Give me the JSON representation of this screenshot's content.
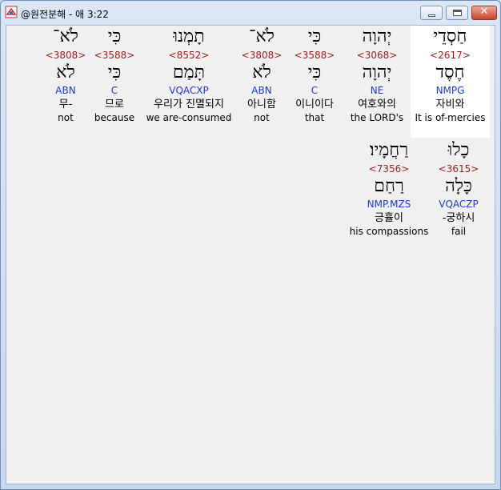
{
  "window": {
    "title": "@원전분해 - 애 3:22"
  },
  "verse": {
    "row1": [
      {
        "heb": "חַסְדֵי",
        "strong": "<2617>",
        "lemma": "חֶסֶד",
        "morph": "NMPG",
        "kor": "자비와",
        "eng": "It is of-mercies"
      },
      {
        "heb": "יְהוָה",
        "strong": "<3068>",
        "lemma": "יְהוָה",
        "morph": "NE",
        "kor": "여호와의",
        "eng": "the LORD's"
      },
      {
        "heb": "כִּי",
        "strong": "<3588>",
        "lemma": "כִּי",
        "morph": "C",
        "kor": "이니이다",
        "eng": "that"
      },
      {
        "heb": "לֹא־",
        "strong": "<3808>",
        "lemma": "לֹא",
        "morph": "ABN",
        "kor": "아니함",
        "eng": "not"
      },
      {
        "heb": "תָמְנוּ",
        "strong": "<8552>",
        "lemma": "תָּמַם",
        "morph": "VQACXP",
        "kor": "우리가 진멸되지",
        "eng": "we are-consumed"
      },
      {
        "heb": "כִּי",
        "strong": "<3588>",
        "lemma": "כִּי",
        "morph": "C",
        "kor": "므로",
        "eng": "because"
      },
      {
        "heb": "לֹא־",
        "strong": "<3808>",
        "lemma": "לֹא",
        "morph": "ABN",
        "kor": "무-",
        "eng": "not"
      }
    ],
    "row2": [
      {
        "heb": "כָלוּ",
        "strong": "<3615>",
        "lemma": "כָּלָה",
        "morph": "VQACZP",
        "kor": "-궁하시",
        "eng": "fail"
      },
      {
        "heb": "רַחֲמָיו׃",
        "strong": "<7356>",
        "lemma": "רַחַם",
        "morph": "NMP.MZS",
        "kor": "긍휼이",
        "eng": "his compassions"
      }
    ]
  }
}
